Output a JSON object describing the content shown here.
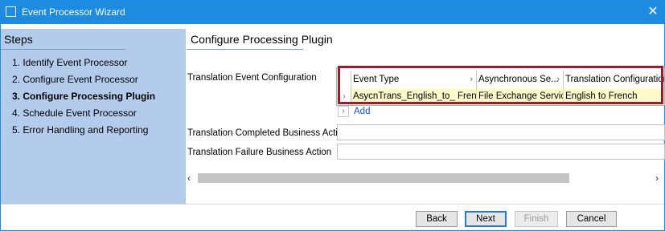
{
  "window": {
    "title": "Event Processor Wizard",
    "close_glyph": "✕"
  },
  "steps": {
    "title": "Steps",
    "items": [
      {
        "label": "1. Identify Event Processor",
        "active": false
      },
      {
        "label": "2. Configure Event Processor",
        "active": false
      },
      {
        "label": "3. Configure Processing Plugin",
        "active": true
      },
      {
        "label": "4. Schedule Event Processor",
        "active": false
      },
      {
        "label": "5. Error Handling and Reporting",
        "active": false
      }
    ]
  },
  "content": {
    "title": "Configure Processing Plugin",
    "translation_event_label": "Translation Event Configuration",
    "grid": {
      "columns": [
        "Event Type",
        "Asynchronous Se...",
        "Translation Configuration"
      ],
      "chevron": "›",
      "row_marker": "›",
      "rows": [
        [
          "AsycnTrans_English_to_ French",
          "File Exchange Service",
          "English to French"
        ]
      ]
    },
    "add_marker": "›",
    "add_label": "Add",
    "completed_label": "Translation Completed Business Action",
    "completed_value": "",
    "failure_label": "Translation Failure Business Action",
    "failure_value": "",
    "scroll_left": "‹",
    "scroll_right": "›"
  },
  "footer": {
    "back": "Back",
    "next": "Next",
    "finish": "Finish",
    "cancel": "Cancel"
  },
  "colors": {
    "titlebar": "#1d8ce0",
    "steps_panel": "#b3cceb",
    "highlight_border": "#9b1c2c",
    "selected_row": "#fffacc",
    "link": "#1a4fd6"
  }
}
